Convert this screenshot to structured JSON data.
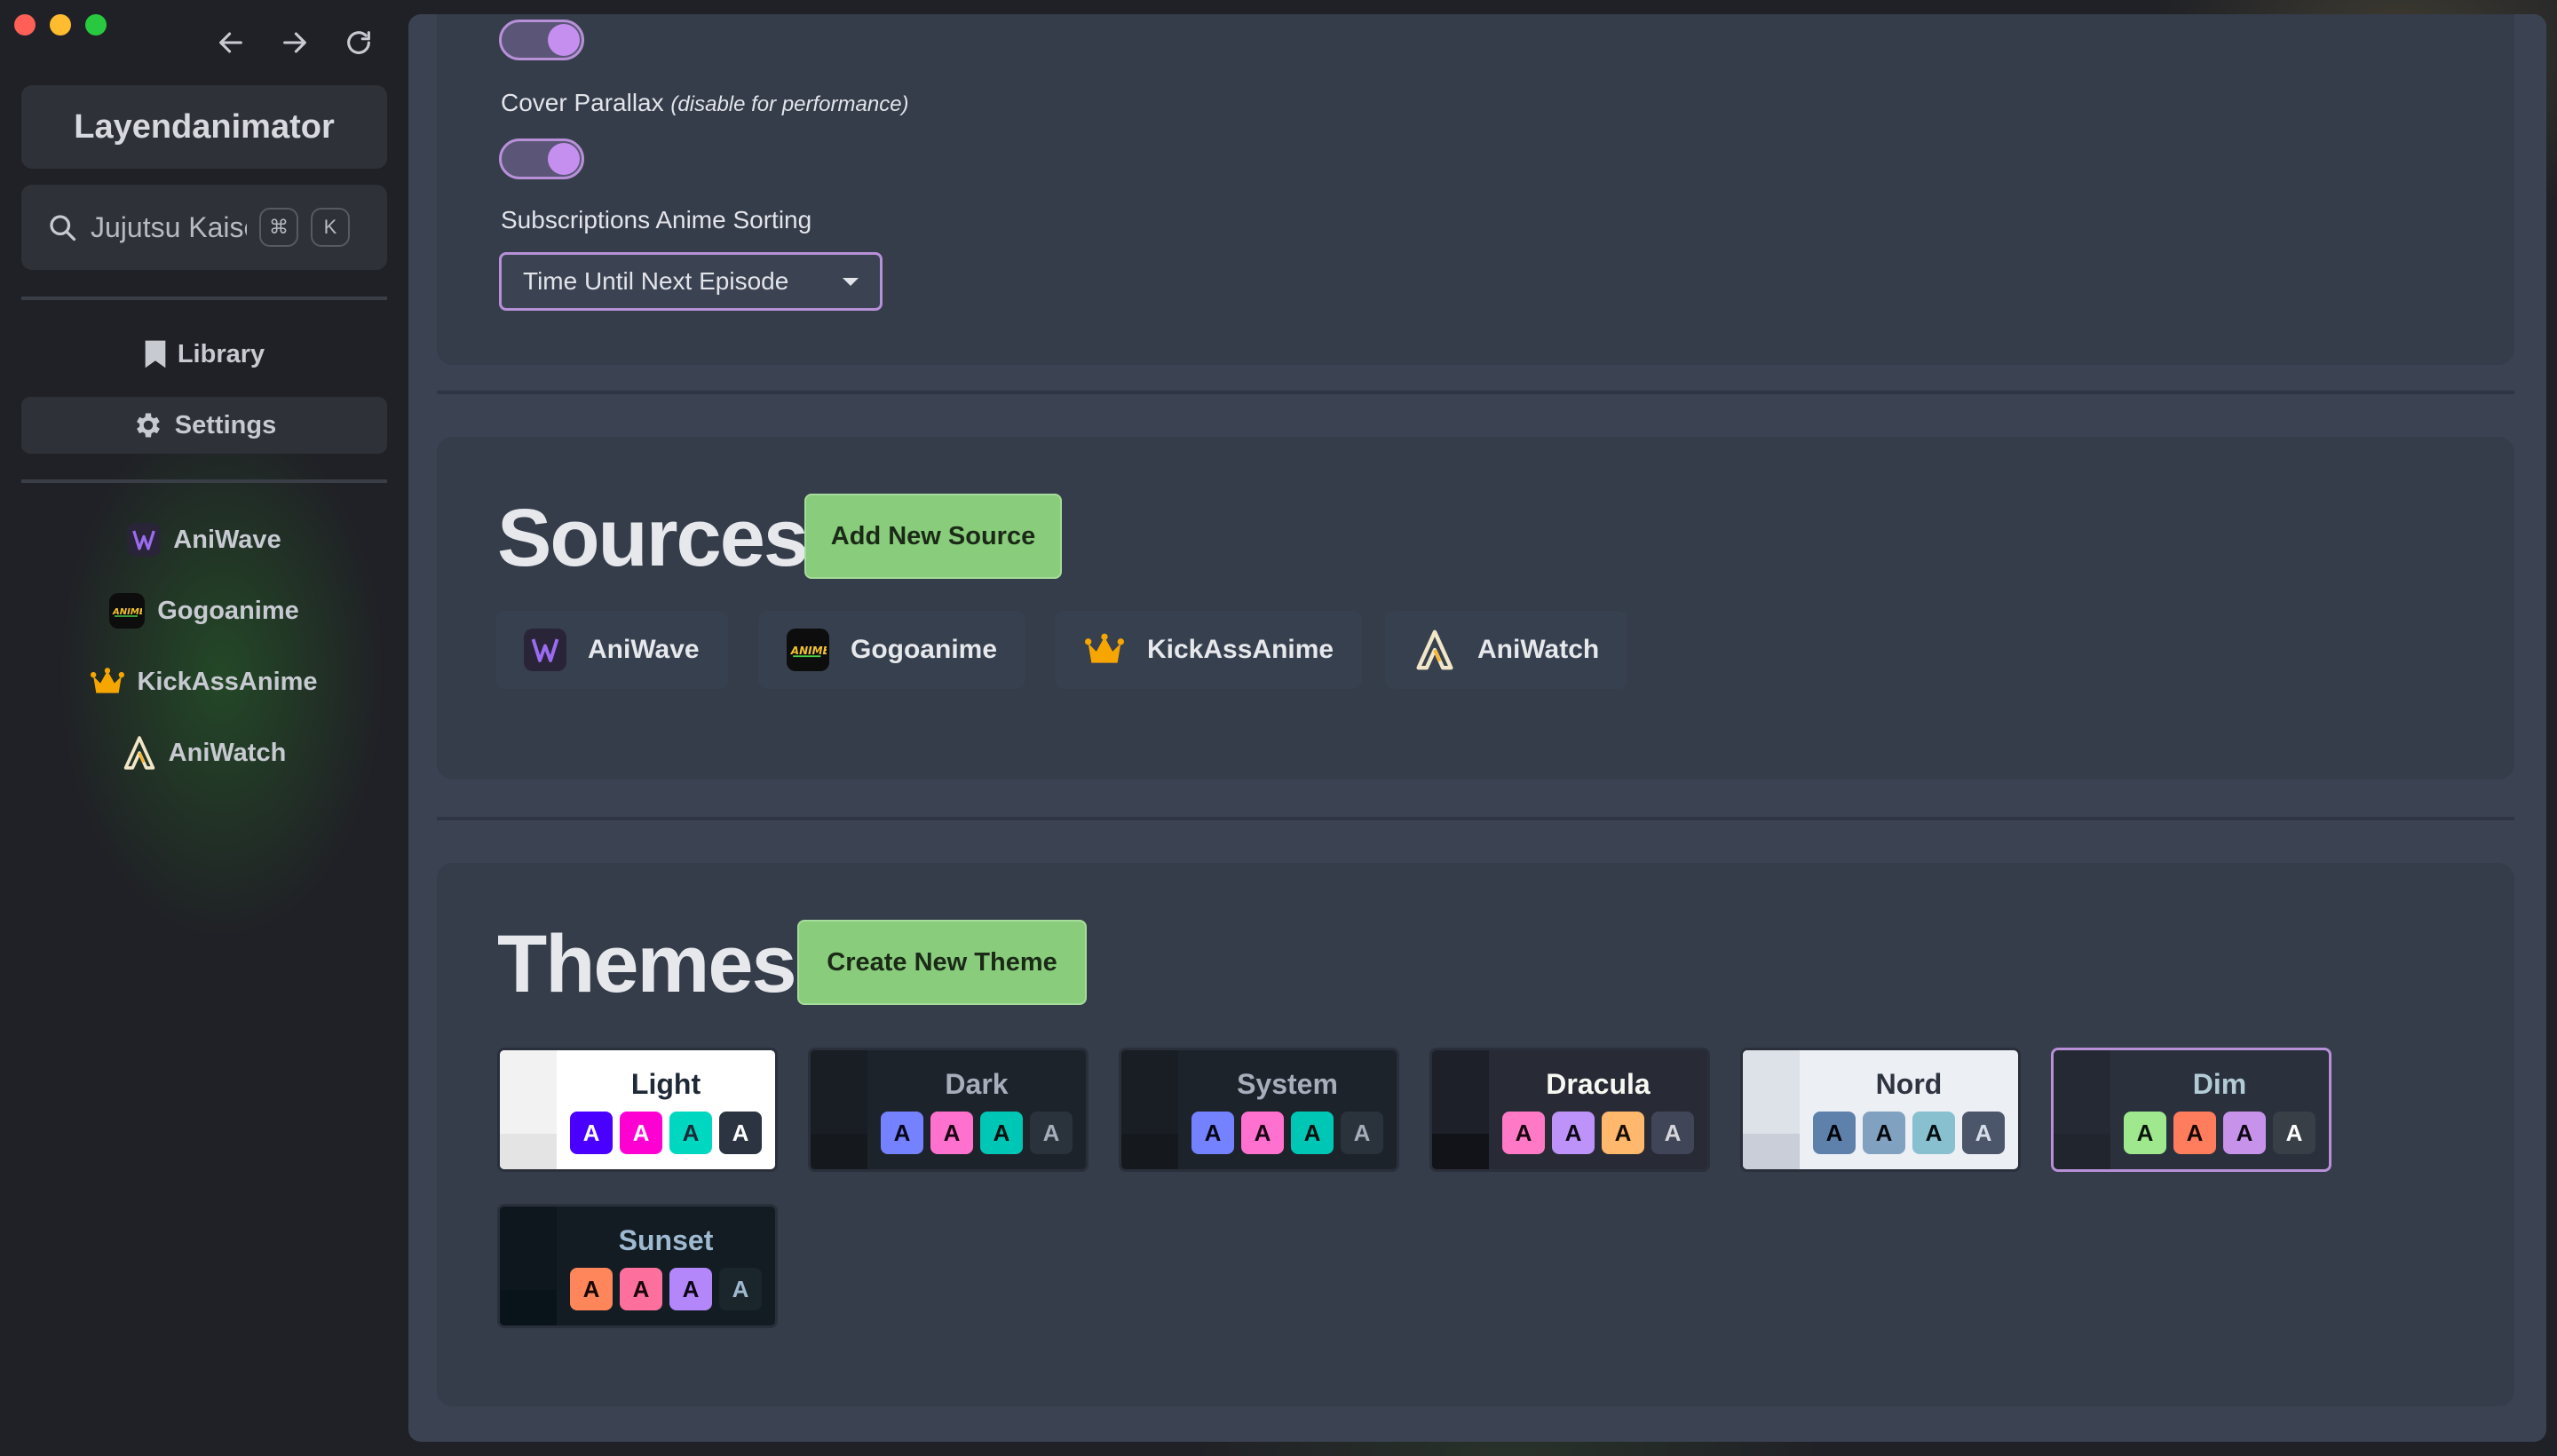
{
  "window": {
    "app_title": "Layendanimator"
  },
  "search": {
    "value": "Jujutsu Kaisen",
    "shortcut_mod": "⌘",
    "shortcut_key": "K"
  },
  "nav": {
    "library": "Library",
    "settings": "Settings"
  },
  "sidebar_sources": [
    "AniWave",
    "Gogoanime",
    "KickAssAnime",
    "AniWatch"
  ],
  "settings": {
    "cover_parallax_label": "Cover Parallax",
    "cover_parallax_note": "(disable for performance)",
    "cover_parallax_on": true,
    "top_toggle_on": true,
    "sorting_label": "Subscriptions Anime Sorting",
    "sorting_value": "Time Until Next Episode"
  },
  "sources_section": {
    "title": "Sources",
    "add_button": "Add New Source",
    "items": [
      "AniWave",
      "Gogoanime",
      "KickAssAnime",
      "AniWatch"
    ]
  },
  "themes_section": {
    "title": "Themes",
    "create_button": "Create New Theme",
    "selected": "Dim",
    "themes": [
      {
        "name": "Light",
        "bg": "#ffffff",
        "strip_top": "#f2f2f2",
        "strip_bot": "#e4e4e4",
        "text": "#1f2937",
        "swatches": [
          {
            "bg": "#4a00ff",
            "fg": "#ffffff"
          },
          {
            "bg": "#ff00d3",
            "fg": "#ffffff"
          },
          {
            "bg": "#00d7c0",
            "fg": "#1f2937"
          },
          {
            "bg": "#2b3440",
            "fg": "#ffffff"
          }
        ]
      },
      {
        "name": "Dark",
        "bg": "#1d232a",
        "strip_top": "#191e24",
        "strip_bot": "#15191e",
        "text": "#a6adbb",
        "swatches": [
          {
            "bg": "#7582ff",
            "fg": "#050617"
          },
          {
            "bg": "#ff71cf",
            "fg": "#190211"
          },
          {
            "bg": "#00c7b5",
            "fg": "#000e0c"
          },
          {
            "bg": "#2a323c",
            "fg": "#a6adbb"
          }
        ]
      },
      {
        "name": "System",
        "bg": "#1d232a",
        "strip_top": "#191e24",
        "strip_bot": "#15191e",
        "text": "#a6adbb",
        "swatches": [
          {
            "bg": "#7582ff",
            "fg": "#050617"
          },
          {
            "bg": "#ff71cf",
            "fg": "#190211"
          },
          {
            "bg": "#00c7b5",
            "fg": "#000e0c"
          },
          {
            "bg": "#2a323c",
            "fg": "#a6adbb"
          }
        ]
      },
      {
        "name": "Dracula",
        "bg": "#282a36",
        "strip_top": "#1e2029",
        "strip_bot": "#121318",
        "text": "#f8f8f2",
        "swatches": [
          {
            "bg": "#ff79c6",
            "fg": "#16050e"
          },
          {
            "bg": "#bd93f9",
            "fg": "#0d0815"
          },
          {
            "bg": "#ffb86c",
            "fg": "#160d04"
          },
          {
            "bg": "#414558",
            "fg": "#d6d7db"
          }
        ]
      },
      {
        "name": "Nord",
        "bg": "#eceff4",
        "strip_top": "#dde1e8",
        "strip_bot": "#c9ced8",
        "text": "#2e3440",
        "swatches": [
          {
            "bg": "#5e81ac",
            "fg": "#03060b"
          },
          {
            "bg": "#81a1c1",
            "fg": "#06090d"
          },
          {
            "bg": "#88c0d0",
            "fg": "#060e10"
          },
          {
            "bg": "#4c566a",
            "fg": "#d8dee9"
          }
        ]
      },
      {
        "name": "Dim",
        "bg": "#2a303c",
        "strip_top": "#242933",
        "strip_bot": "#20252e",
        "text": "#b2ccd6",
        "swatches": [
          {
            "bg": "#9fe88d",
            "fg": "#091308"
          },
          {
            "bg": "#ff7d5c",
            "fg": "#160603"
          },
          {
            "bg": "#c792e9",
            "fg": "#0e0813"
          },
          {
            "bg": "#383f47",
            "fg": "#ffffff"
          }
        ]
      },
      {
        "name": "Sunset",
        "bg": "#121c22",
        "strip_top": "#0e171e",
        "strip_bot": "#09131a",
        "text": "#9fb9d0",
        "swatches": [
          {
            "bg": "#ff865b",
            "fg": "#160603"
          },
          {
            "bg": "#fd6f9c",
            "fg": "#160409"
          },
          {
            "bg": "#b387fa",
            "fg": "#0c0715"
          },
          {
            "bg": "#1b262c",
            "fg": "#9fb9d0"
          }
        ]
      }
    ]
  }
}
